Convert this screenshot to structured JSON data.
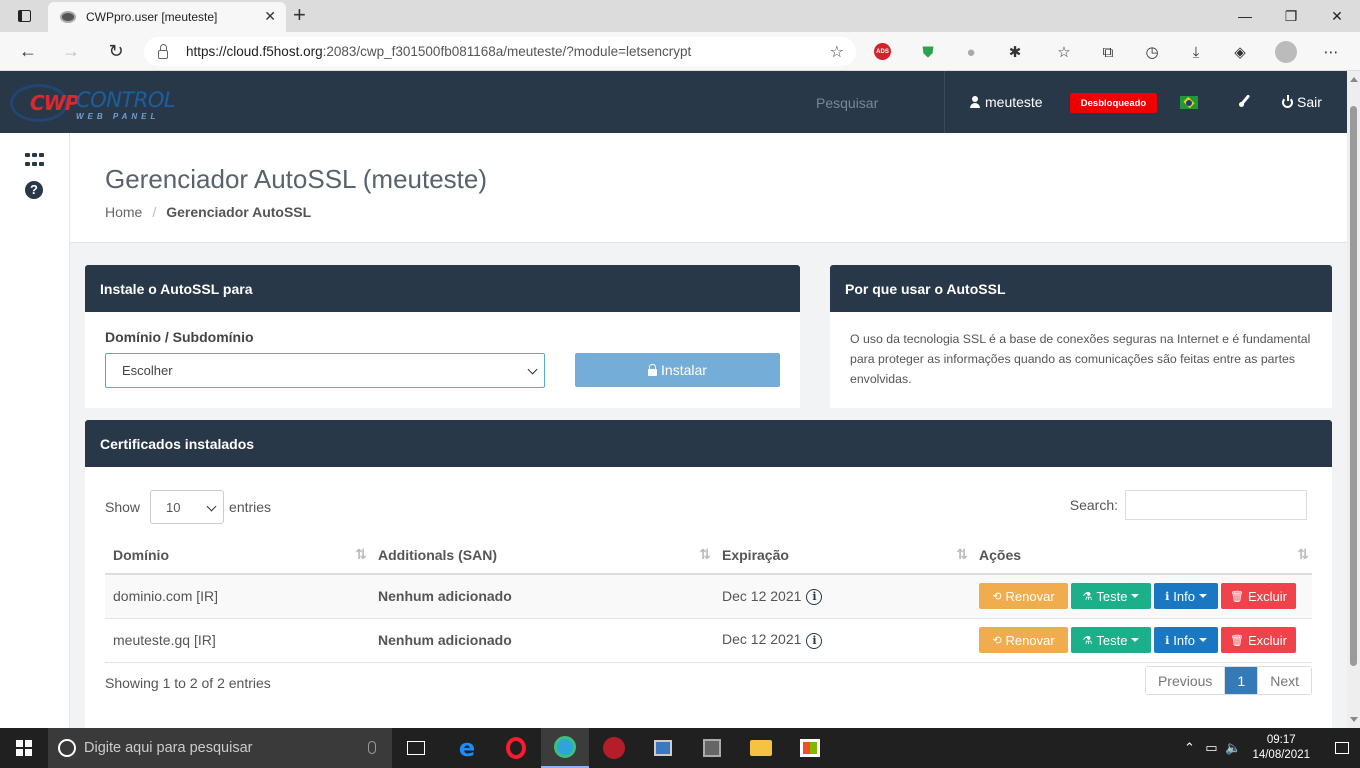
{
  "browser": {
    "tab_title": "CWPpro.user [meuteste]",
    "tab_close": "✕",
    "new_tab": "+",
    "url_host": "https://cloud.f5host.org",
    "url_rest": ":2083/cwp_f301500fb081168a/meuteste/?module=letsencrypt",
    "window_controls": [
      "—",
      "❐",
      "✕"
    ],
    "ads_label": "ADS"
  },
  "header": {
    "logo_cwp": "CWP",
    "logo_control": "CONTROL",
    "logo_sub": "WEB PANEL",
    "search": "Pesquisar",
    "username": "meuteste",
    "status_badge": "Desbloqueado",
    "logout": "Sair"
  },
  "page": {
    "title": "Gerenciador AutoSSL (meuteste)",
    "breadcrumb_home": "Home",
    "breadcrumb_sep": "/",
    "breadcrumb_current": "Gerenciador AutoSSL"
  },
  "install_panel": {
    "title": "Instale o AutoSSL para",
    "field_label": "Domínio / Subdomínio",
    "select_value": "Escolher",
    "install_button": "Instalar"
  },
  "why_panel": {
    "title": "Por que usar o AutoSSL",
    "text": "O uso da tecnologia SSL é a base de conexões seguras na Internet e é fundamental para proteger as informações quando as comunicações são feitas entre as partes envolvidas."
  },
  "certs_panel": {
    "title": "Certificados instalados",
    "show_label": "Show",
    "entries_value": "10",
    "entries_label": "entries",
    "search_label": "Search:",
    "columns": [
      "Domínio",
      "Additionals (SAN)",
      "Expiração",
      "Ações"
    ],
    "rows": [
      {
        "domain": "dominio.com [IR]",
        "san": "Nenhum adicionado",
        "expiration": "Dec 12 2021"
      },
      {
        "domain": "meuteste.gq [IR]",
        "san": "Nenhum adicionado",
        "expiration": "Dec 12 2021"
      }
    ],
    "actions": {
      "renew": "Renovar",
      "test": "Teste",
      "info": "Info",
      "delete": "Excluir"
    },
    "showing": "Showing 1 to 2 of 2 entries",
    "pagination": {
      "previous": "Previous",
      "current": "1",
      "next": "Next"
    }
  },
  "taskbar": {
    "search_placeholder": "Digite aqui para pesquisar",
    "time": "09:17",
    "date": "14/08/2021"
  },
  "colors": {
    "header_bg": "#283848",
    "install_button": "#74add8",
    "renew": "#f0ad4e",
    "test": "#1bb08a",
    "info": "#1a78c2",
    "delete": "#f0424b",
    "badge": "#ee0000"
  },
  "icons": [
    "tab-actions-icon",
    "favicon",
    "back-icon",
    "forward-icon",
    "refresh-icon",
    "lock-icon",
    "favorite-add-icon",
    "adblock-icon",
    "shield-icon",
    "extension-icon",
    "puzzle-icon",
    "favorites-icon",
    "collections-icon",
    "history-icon",
    "download-icon",
    "extensions-icon",
    "profile-avatar",
    "more-icon",
    "user-icon",
    "brazil-flag-icon",
    "brush-icon",
    "power-icon",
    "apps-grid-icon",
    "help-icon",
    "info-circle-icon",
    "sort-icon",
    "windows-start-icon",
    "search-circle-icon",
    "mic-icon",
    "task-view-icon"
  ]
}
